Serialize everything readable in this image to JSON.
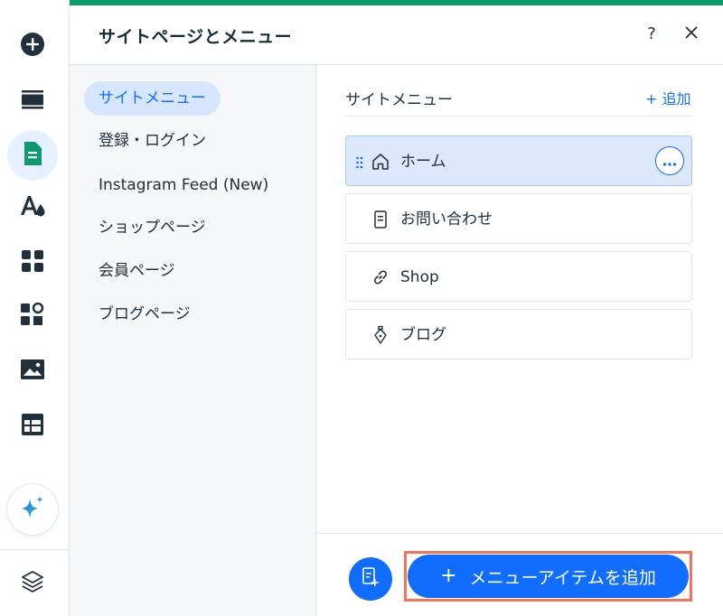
{
  "colors": {
    "accent": "#116dff",
    "brand_top_line": "#0d9b6e",
    "active_nav_bg": "#d6e6fe",
    "selected_item_bg": "#dce9fd",
    "highlight_border": "#f2745a"
  },
  "rail": {
    "items": [
      {
        "icon": "add-circle-icon"
      },
      {
        "icon": "sections-icon"
      },
      {
        "icon": "pages-icon",
        "active": true
      },
      {
        "icon": "design-fonts-icon"
      },
      {
        "icon": "apps-grid-icon"
      },
      {
        "icon": "add-apps-puzzle-icon"
      },
      {
        "icon": "media-image-icon"
      },
      {
        "icon": "cms-table-icon"
      },
      {
        "icon": "ai-sparkle-icon"
      },
      {
        "icon": "layers-icon"
      }
    ]
  },
  "panel": {
    "title": "サイトページとメニュー",
    "help_label": "?",
    "close_icon": "close-icon"
  },
  "nav": {
    "items": [
      {
        "label": "サイトメニュー",
        "active": true
      },
      {
        "label": "登録・ログイン"
      },
      {
        "label": "Instagram Feed (New)"
      },
      {
        "label": "ショップページ"
      },
      {
        "label": "会員ページ"
      },
      {
        "label": "ブログページ"
      }
    ]
  },
  "content": {
    "section_title": "サイトメニュー",
    "add_label": "+ 追加",
    "menu_items": [
      {
        "label": "ホーム",
        "icon": "home-icon",
        "selected": true
      },
      {
        "label": "お問い合わせ",
        "icon": "page-icon"
      },
      {
        "label": "Shop",
        "icon": "link-icon"
      },
      {
        "label": "ブログ",
        "icon": "pen-nib-icon"
      }
    ],
    "more_icon": "more-actions-icon",
    "footer": {
      "add_page_icon": "add-page-icon",
      "primary_button_plus": "+",
      "primary_button_label": "メニューアイテムを追加"
    }
  }
}
